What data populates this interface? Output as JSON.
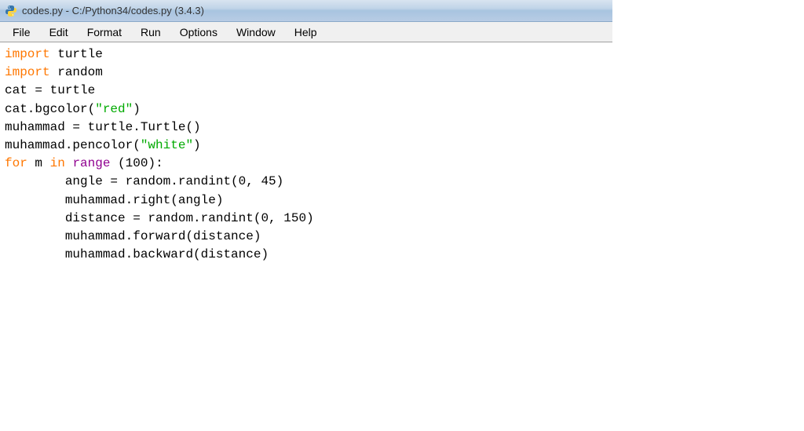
{
  "window": {
    "title": "codes.py - C:/Python34/codes.py (3.4.3)"
  },
  "menu": {
    "items": [
      "File",
      "Edit",
      "Format",
      "Run",
      "Options",
      "Window",
      "Help"
    ]
  },
  "code": {
    "l1_kw": "import",
    "l1_rest": " turtle",
    "l2_kw": "import",
    "l2_rest": " random",
    "l3": "cat = turtle",
    "l4_a": "cat.bgcolor(",
    "l4_str": "\"red\"",
    "l4_b": ")",
    "l5": "muhammad = turtle.Turtle()",
    "l6_a": "muhammad.pencolor(",
    "l6_str": "\"white\"",
    "l6_b": ")",
    "l7_for": "for",
    "l7_m": " m ",
    "l7_in": "in",
    "l7_sp": " ",
    "l7_range": "range",
    "l7_rest": " (100):",
    "l8": "        angle = random.randint(0, 45)",
    "l9": "        muhammad.right(angle)",
    "l10": "        distance = random.randint(0, 150)",
    "l11": "        muhammad.forward(distance)",
    "l12": "        muhammad.backward(distance)"
  }
}
